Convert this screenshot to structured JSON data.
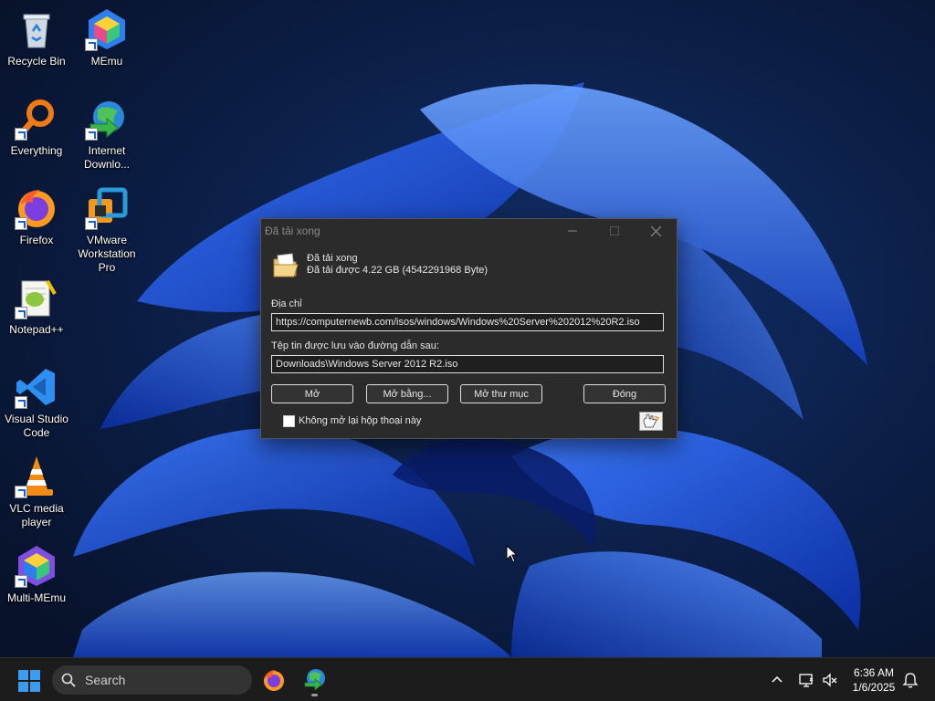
{
  "desktop": {
    "icons": [
      {
        "label": "Recycle Bin"
      },
      {
        "label": "MEmu"
      },
      {
        "label": "Everything"
      },
      {
        "label": "Internet Downlo..."
      },
      {
        "label": "Firefox"
      },
      {
        "label": "VMware Workstation Pro"
      },
      {
        "label": "Notepad++"
      },
      {
        "label": "Visual Studio Code"
      },
      {
        "label": "VLC media player"
      },
      {
        "label": "Multi-MEmu"
      }
    ]
  },
  "dialog": {
    "title": "Đã tải xong",
    "status_line1": "Đã tải xong",
    "status_line2": "Đã tải được 4.22  GB (4542291968 Byte)",
    "address_label": "Địa chỉ",
    "address_value": "https://computernewb.com/isos/windows/Windows%20Server%202012%20R2.iso",
    "save_path_label": "Tệp tin được lưu vào đường dẫn sau:",
    "save_path_value": "Downloads\\Windows Server 2012 R2.iso",
    "buttons": {
      "open": "Mở",
      "open_with": "Mở bằng...",
      "open_folder": "Mở thư mục",
      "close": "Đóng"
    },
    "checkbox_label": "Không mở lại hộp thoại này",
    "checkbox_checked": false
  },
  "taskbar": {
    "search_placeholder": "Search",
    "time": "6:36 AM",
    "date": "1/6/2025",
    "apps": [
      "firefox-icon",
      "internet-download-manager-icon"
    ]
  },
  "colors": {
    "dialog_bg": "#2b2b2b",
    "taskbar_bg": "#1c1c1c",
    "accent": "#1a5fd0"
  }
}
